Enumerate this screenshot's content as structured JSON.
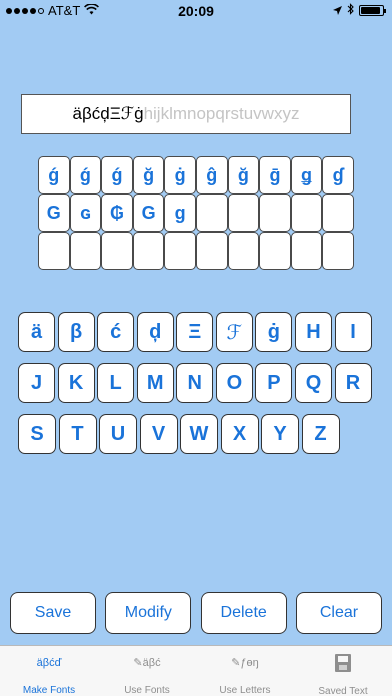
{
  "status_bar": {
    "carrier": "AT&T",
    "wifi": "wifi-icon",
    "time": "20:09",
    "location": "location-arrow-icon",
    "bluetooth": "bluetooth-icon",
    "battery_level": 0.9
  },
  "preview": {
    "typed": "äβćḑΞℱġ",
    "rest": "hijklmnopqrstuvwxyz"
  },
  "variants": {
    "rows": [
      [
        "ǵ",
        "ǵ",
        "ǵ",
        "ğ",
        "ġ",
        "ĝ",
        "ğ",
        "ḡ",
        "ǥ",
        "ɠ"
      ],
      [
        "G",
        "ɢ",
        "₲",
        "G",
        "ɡ",
        "",
        "",
        "",
        "",
        ""
      ],
      [
        "",
        "",
        "",
        "",
        "",
        "",
        "",
        "",
        "",
        ""
      ]
    ]
  },
  "keyboard": {
    "rows": [
      [
        "ä",
        "β",
        "ć",
        "ḑ",
        "Ξ",
        "ℱ",
        "ġ",
        "H",
        "I"
      ],
      [
        "J",
        "K",
        "L",
        "M",
        "N",
        "O",
        "P",
        "Q",
        "R"
      ],
      [
        "S",
        "T",
        "U",
        "V",
        "W",
        "X",
        "Y",
        "Z"
      ]
    ]
  },
  "actions": {
    "save": "Save",
    "modify": "Modify",
    "delete": "Delete",
    "clear": "Clear"
  },
  "tabs": [
    {
      "icon_text": "äβćď",
      "label": "Make Fonts"
    },
    {
      "icon_text": "✎äβć",
      "label": "Use Fonts"
    },
    {
      "icon_text": "✎ƒɵŋ",
      "label": "Use Letters"
    },
    {
      "icon_text": "",
      "label": "Saved Text"
    }
  ],
  "colors": {
    "background": "#a2cbf3",
    "accent": "#1a73d9"
  }
}
